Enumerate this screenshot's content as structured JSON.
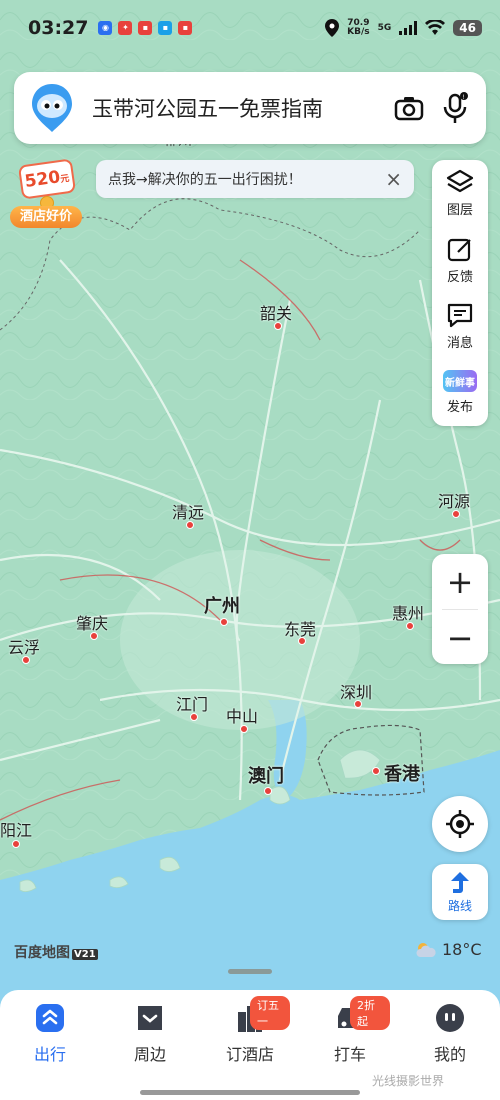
{
  "status_bar": {
    "time": "03:27",
    "net_speed": "70.9",
    "net_unit": "KB/s",
    "network": "5G",
    "battery": "46"
  },
  "search": {
    "query": "玉带河公园五一免票指南"
  },
  "notice": {
    "text": "点我→解决你的五一出行困扰！",
    "close": "×"
  },
  "promo": {
    "price": "520",
    "price_unit": "元",
    "tag": "酒店好价"
  },
  "side_panel": {
    "items": [
      {
        "label": "图层",
        "icon": "layers-icon"
      },
      {
        "label": "反馈",
        "icon": "feedback-icon"
      },
      {
        "label": "消息",
        "icon": "message-icon"
      },
      {
        "label": "发布",
        "icon": "new-post-icon",
        "badge": "新鲜事"
      }
    ]
  },
  "zoom": {
    "plus": "+",
    "minus": "−"
  },
  "route_button": {
    "label": "路线"
  },
  "brand": {
    "name": "百度地图",
    "version": "V21"
  },
  "weather": {
    "temp": "18°C"
  },
  "map_labels": {
    "shaoguan": "韶关",
    "qingyuan": "清远",
    "heyuan": "河源",
    "guangzhou": "广州",
    "zhaoqing": "肇庆",
    "dongguan": "东莞",
    "huizhou": "惠州",
    "yunfu": "云浮",
    "shenzhen": "深圳",
    "jiangmen": "江门",
    "zhongshan": "中山",
    "macau": "澳门",
    "hongkong": "香港",
    "yangjiang": "阳江",
    "top_cut": "郴州"
  },
  "tabs": [
    {
      "label": "出行",
      "icon": "travel-icon",
      "active": true
    },
    {
      "label": "周边",
      "icon": "nearby-icon"
    },
    {
      "label": "订酒店",
      "icon": "hotel-icon",
      "badge": "订五一"
    },
    {
      "label": "打车",
      "icon": "taxi-icon",
      "badge": "2折起"
    },
    {
      "label": "我的",
      "icon": "profile-icon"
    }
  ],
  "watermark": "光线摄影世界",
  "colors": {
    "land": "#a8dcc3",
    "water": "#8fd3ef",
    "accent": "#2a6ff0",
    "badge": "#f2553d"
  }
}
